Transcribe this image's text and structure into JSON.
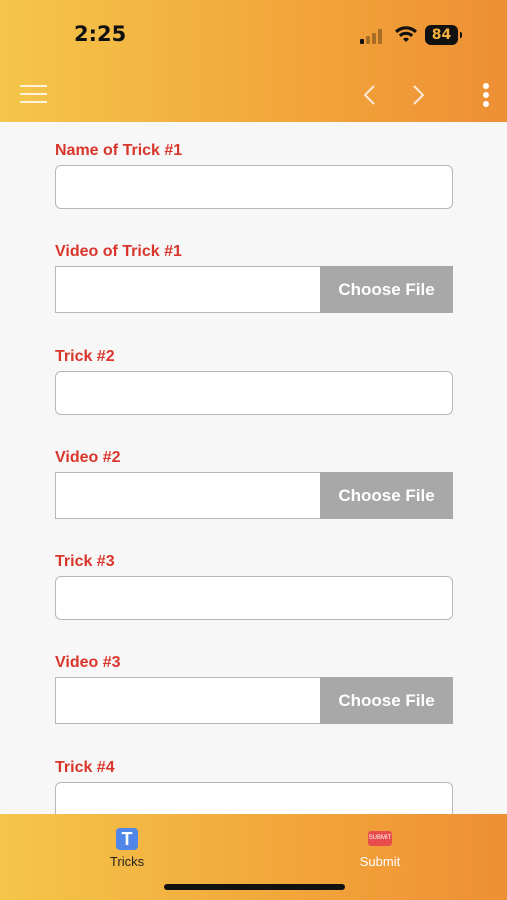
{
  "status": {
    "time": "2:25",
    "battery": "84"
  },
  "form": {
    "fields": [
      {
        "label": "Name of Trick #1",
        "kind": "text",
        "value": ""
      },
      {
        "label": "Video of Trick #1",
        "kind": "file",
        "button": "Choose File"
      },
      {
        "label": "Trick #2",
        "kind": "text",
        "value": ""
      },
      {
        "label": "Video #2",
        "kind": "file",
        "button": "Choose File"
      },
      {
        "label": "Trick #3",
        "kind": "text",
        "value": ""
      },
      {
        "label": "Video #3",
        "kind": "file",
        "button": "Choose File"
      },
      {
        "label": "Trick #4",
        "kind": "text",
        "value": ""
      }
    ]
  },
  "tabs": [
    {
      "label": "Tricks",
      "icon": "tricks-t-icon",
      "icon_text": "T",
      "active": true
    },
    {
      "label": "Submit",
      "icon": "submit-icon",
      "icon_text": "SUBMIT",
      "active": false
    }
  ],
  "colors": {
    "label": "#d9362b",
    "header_start": "#f4c64a",
    "header_end": "#ee8f35",
    "file_button": "#a8a8a8"
  }
}
